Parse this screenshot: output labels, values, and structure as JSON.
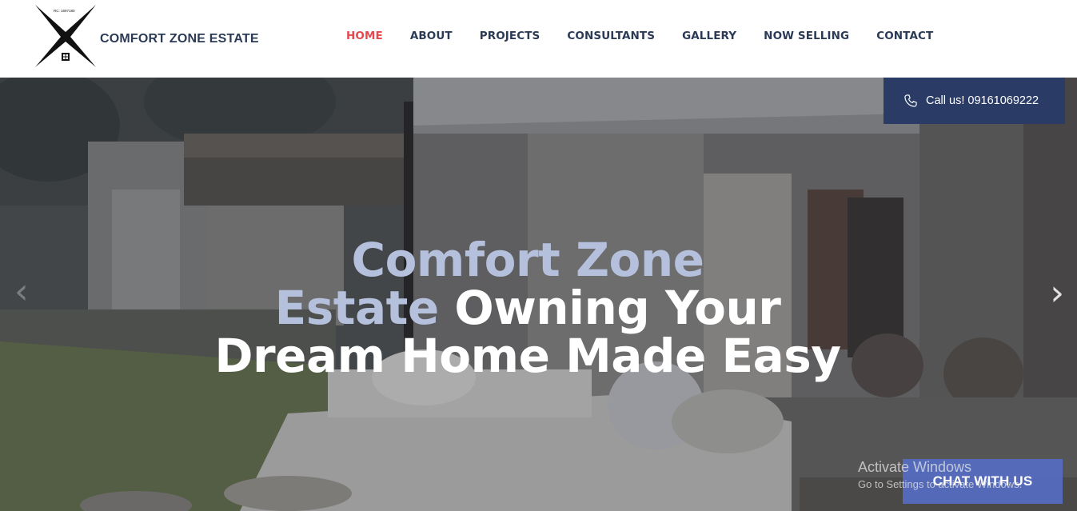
{
  "brand": {
    "name": "COMFORT ZONE ESTATE",
    "rc_number": "RC: 1697180"
  },
  "nav": {
    "items": [
      {
        "label": "HOME",
        "active": true
      },
      {
        "label": "ABOUT",
        "active": false
      },
      {
        "label": "PROJECTS",
        "active": false
      },
      {
        "label": "CONSULTANTS",
        "active": false
      },
      {
        "label": "GALLERY",
        "active": false
      },
      {
        "label": "NOW SELLING",
        "active": false
      },
      {
        "label": "CONTACT",
        "active": false
      }
    ]
  },
  "hero": {
    "headline_accent_1": "Comfort Zone",
    "headline_accent_2": "Estate",
    "headline_rest_1": " Owning Your",
    "headline_rest_2": "Dream Home Made Easy",
    "prev_arrow": "‹",
    "next_arrow": "›"
  },
  "call": {
    "label": "Call us! 09161069222",
    "icon": "phone-icon"
  },
  "chat": {
    "label": "CHAT WITH US"
  },
  "watermark": {
    "line1": "Activate Windows",
    "line2": "Go to Settings to activate Windows."
  },
  "colors": {
    "brand_navy": "#2b3a55",
    "active_nav": "#e5484d",
    "call_box": "#2a3b66",
    "headline_accent": "#b5c0dd",
    "chat_button": "#556ec8"
  }
}
